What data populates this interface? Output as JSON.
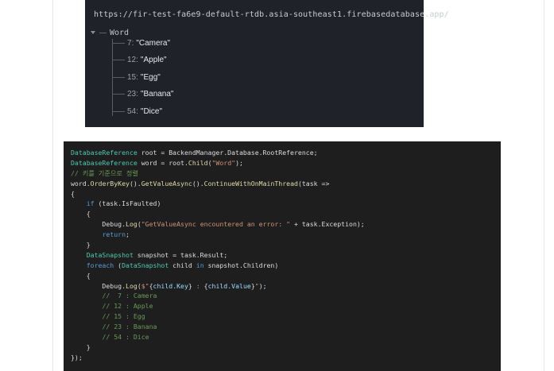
{
  "db": {
    "url": "https://fir-test-fa6e9-default-rtdb.asia-southeast1.firebasedatabase.app/",
    "root_key": "Word",
    "separator": ":",
    "children": [
      {
        "key": "7",
        "value": "\"Camera\""
      },
      {
        "key": "12",
        "value": "\"Apple\""
      },
      {
        "key": "15",
        "value": "\"Egg\""
      },
      {
        "key": "23",
        "value": "\"Banana\""
      },
      {
        "key": "54",
        "value": "\"Dice\""
      }
    ]
  },
  "code": {
    "lines": [
      [
        {
          "t": "t",
          "v": "DatabaseReference"
        },
        {
          "t": "p",
          "v": " root = BackendManager.Database.RootReference;"
        }
      ],
      [
        {
          "t": "t",
          "v": "DatabaseReference"
        },
        {
          "t": "p",
          "v": " word = root."
        },
        {
          "t": "m",
          "v": "Child"
        },
        {
          "t": "p",
          "v": "("
        },
        {
          "t": "s",
          "v": "\"Word\""
        },
        {
          "t": "p",
          "v": ");"
        }
      ],
      [
        {
          "t": "c",
          "v": "// 키를 기준으로 정렬"
        }
      ],
      [
        {
          "t": "p",
          "v": "word."
        },
        {
          "t": "m",
          "v": "OrderByKey"
        },
        {
          "t": "p",
          "v": "()."
        },
        {
          "t": "m",
          "v": "GetValueAsync"
        },
        {
          "t": "p",
          "v": "()."
        },
        {
          "t": "m",
          "v": "ContinueWithOnMainThread"
        },
        {
          "t": "p",
          "v": "(task =>"
        }
      ],
      [
        {
          "t": "p",
          "v": "{"
        }
      ],
      [
        {
          "t": "p",
          "v": "    "
        },
        {
          "t": "k",
          "v": "if"
        },
        {
          "t": "p",
          "v": " (task.IsFaulted)"
        }
      ],
      [
        {
          "t": "p",
          "v": "    {"
        }
      ],
      [
        {
          "t": "p",
          "v": "        Debug."
        },
        {
          "t": "m",
          "v": "Log"
        },
        {
          "t": "p",
          "v": "("
        },
        {
          "t": "s",
          "v": "\"GetValueAsync encountered an error: \""
        },
        {
          "t": "p",
          "v": " + task.Exception);"
        }
      ],
      [
        {
          "t": "p",
          "v": "        "
        },
        {
          "t": "k",
          "v": "return"
        },
        {
          "t": "p",
          "v": ";"
        }
      ],
      [
        {
          "t": "p",
          "v": "    }"
        }
      ],
      [
        {
          "t": "p",
          "v": "    "
        },
        {
          "t": "t",
          "v": "DataSnapshot"
        },
        {
          "t": "p",
          "v": " snapshot = task.Result;"
        }
      ],
      [
        {
          "t": "p",
          "v": "    "
        },
        {
          "t": "k",
          "v": "foreach"
        },
        {
          "t": "p",
          "v": " ("
        },
        {
          "t": "t",
          "v": "DataSnapshot"
        },
        {
          "t": "p",
          "v": " child "
        },
        {
          "t": "k",
          "v": "in"
        },
        {
          "t": "p",
          "v": " snapshot.Children)"
        }
      ],
      [
        {
          "t": "p",
          "v": "    {"
        }
      ],
      [
        {
          "t": "p",
          "v": "        Debug."
        },
        {
          "t": "m",
          "v": "Log"
        },
        {
          "t": "p",
          "v": "("
        },
        {
          "t": "s",
          "v": "$\""
        },
        {
          "t": "p",
          "v": "{"
        },
        {
          "t": "v",
          "v": "child.Key"
        },
        {
          "t": "p",
          "v": "}"
        },
        {
          "t": "s",
          "v": " : "
        },
        {
          "t": "p",
          "v": "{"
        },
        {
          "t": "v",
          "v": "child.Value"
        },
        {
          "t": "p",
          "v": "}"
        },
        {
          "t": "s",
          "v": "\""
        },
        {
          "t": "p",
          "v": ");"
        }
      ],
      [
        {
          "t": "p",
          "v": "        "
        },
        {
          "t": "c",
          "v": "//  7 : Camera"
        }
      ],
      [
        {
          "t": "p",
          "v": "        "
        },
        {
          "t": "c",
          "v": "// 12 : Apple"
        }
      ],
      [
        {
          "t": "p",
          "v": "        "
        },
        {
          "t": "c",
          "v": "// 15 : Egg"
        }
      ],
      [
        {
          "t": "p",
          "v": "        "
        },
        {
          "t": "c",
          "v": "// 23 : Banana"
        }
      ],
      [
        {
          "t": "p",
          "v": "        "
        },
        {
          "t": "c",
          "v": "// 54 : Dice"
        }
      ],
      [
        {
          "t": "p",
          "v": "    }"
        }
      ],
      [
        {
          "t": "p",
          "v": "});"
        }
      ]
    ]
  }
}
